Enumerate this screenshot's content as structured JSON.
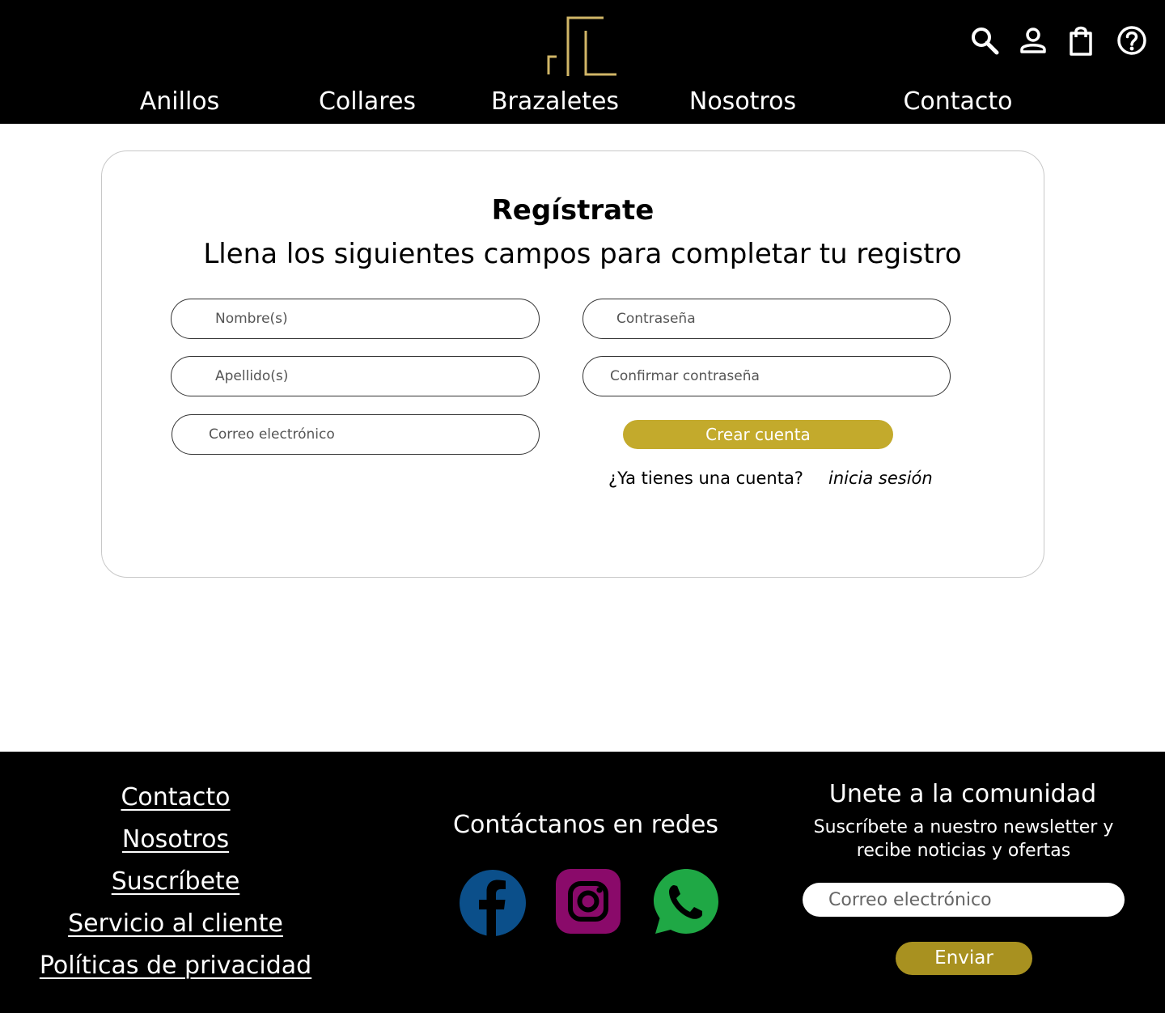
{
  "header": {
    "logo_name": "brand-logo",
    "icons": [
      "search-icon",
      "user-icon",
      "shopping-bag-icon",
      "help-icon"
    ],
    "nav": [
      "Anillos",
      "Collares",
      "Brazaletes",
      "Nosotros",
      "Contacto"
    ]
  },
  "register": {
    "title": "Regístrate",
    "subtitle": "Llena los siguientes campos para completar tu registro",
    "fields": {
      "first_name": "Nombre(s)",
      "last_name": "Apellido(s)",
      "email": "Correo electrónico",
      "password": "Contraseña",
      "confirm_password": "Confirmar contraseña"
    },
    "create_button": "Crear cuenta",
    "have_account": "¿Ya tienes una cuenta?",
    "login_link": "inicia sesión"
  },
  "footer": {
    "links": [
      "Contacto",
      "Nosotros",
      "Suscríbete",
      "Servicio al cliente",
      "Políticas de privacidad"
    ],
    "social_title": "Contáctanos en redes",
    "social_icons": [
      "facebook-icon",
      "instagram-icon",
      "whatsapp-icon"
    ],
    "newsletter": {
      "title": "Unete a la comunidad",
      "text": "Suscríbete a nuestro newsletter y recibe noticias y ofertas",
      "placeholder": "Correo electrónico",
      "button": "Enviar"
    }
  },
  "colors": {
    "gold": "#c3aa2c",
    "dark_gold": "#a89120",
    "logo_gold": "#d1b667",
    "facebook": "#0b4f8a",
    "instagram": "#8a0a6a",
    "whatsapp": "#1fa845"
  }
}
